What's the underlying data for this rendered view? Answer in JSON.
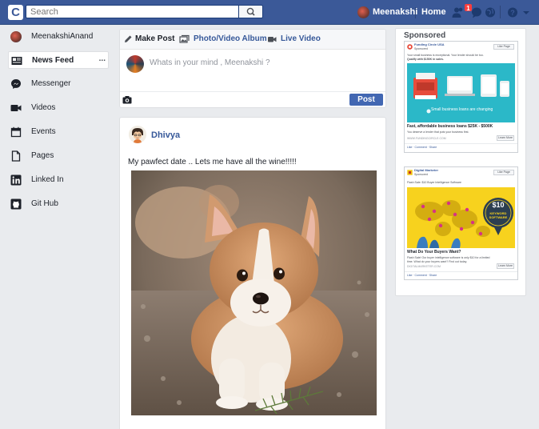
{
  "topbar": {
    "logo": "C",
    "search_placeholder": "Search",
    "user_name": "Meenakshi",
    "home_label": "Home",
    "notification_count": "1"
  },
  "left_nav": {
    "items": [
      {
        "label": "MeenakshiAnand",
        "icon": "avatar"
      },
      {
        "label": "News Feed",
        "icon": "newsfeed-icon",
        "more": "...",
        "active": true
      },
      {
        "label": "Messenger",
        "icon": "messenger-icon"
      },
      {
        "label": "Videos",
        "icon": "video-camera-icon"
      },
      {
        "label": "Events",
        "icon": "calendar-icon"
      },
      {
        "label": "Pages",
        "icon": "document-icon"
      },
      {
        "label": "Linked In",
        "icon": "linkedin-icon"
      },
      {
        "label": "Git Hub",
        "icon": "github-icon"
      }
    ]
  },
  "composer": {
    "tab_make_post": "Make Post",
    "tab_photo_video": "Photo/Video Album",
    "tab_live_video": "Live Video",
    "placeholder": "Whats in your mind , Meenakshi ?",
    "post_button": "Post"
  },
  "feed": {
    "post": {
      "author": "Dhivya",
      "text": "My pawfect date .. Lets me have all the wine!!!!!",
      "photo": "corgi-puppy-photo"
    }
  },
  "sponsored": {
    "title": "Sponsored",
    "ads": [
      {
        "advertiser": "Funding Circle USA",
        "meta": "Sponsored",
        "like_button": "Like Page",
        "body_line1": "Your small business is exceptional. Your lender should be too.",
        "body_line2": "Qualify with $150K in sales.",
        "image_caption": "Small business loans are changing",
        "headline": "Fast, affordable business loans $25K - $500K",
        "description": "You deserve a lender that puts your business first.",
        "url": "WWW.FUNDINGCIRCLE.COM",
        "cta": "Learn More",
        "footer": "Like · Comment · Share"
      },
      {
        "advertiser": "Digital Marketer",
        "meta": "Sponsored",
        "like_button": "Like Page",
        "body_line1": "Flash Sale: $10 Buyer Intelligence Software",
        "image_badge_price": "$10",
        "image_badge_line1": "KEYWORD",
        "image_badge_line2": "SOFTWARE",
        "headline": "What Do Your Buyers Want?",
        "description": "Flash Sale! Our buyer intelligence software is only $10 for a limited time. What do your buyers want? Find out today.",
        "url": "DIGITALMARKETER.COM",
        "cta": "Learn More",
        "footer": "Like · Comment · Share"
      }
    ]
  },
  "colors": {
    "brand_blue": "#3b5998",
    "link_blue": "#365899",
    "button_blue": "#4267b2",
    "page_bg": "#e9ebee",
    "badge_red": "#fa3e3e",
    "ad1_teal": "#2bb8c8",
    "ad2_yellow": "#f7d21e"
  }
}
